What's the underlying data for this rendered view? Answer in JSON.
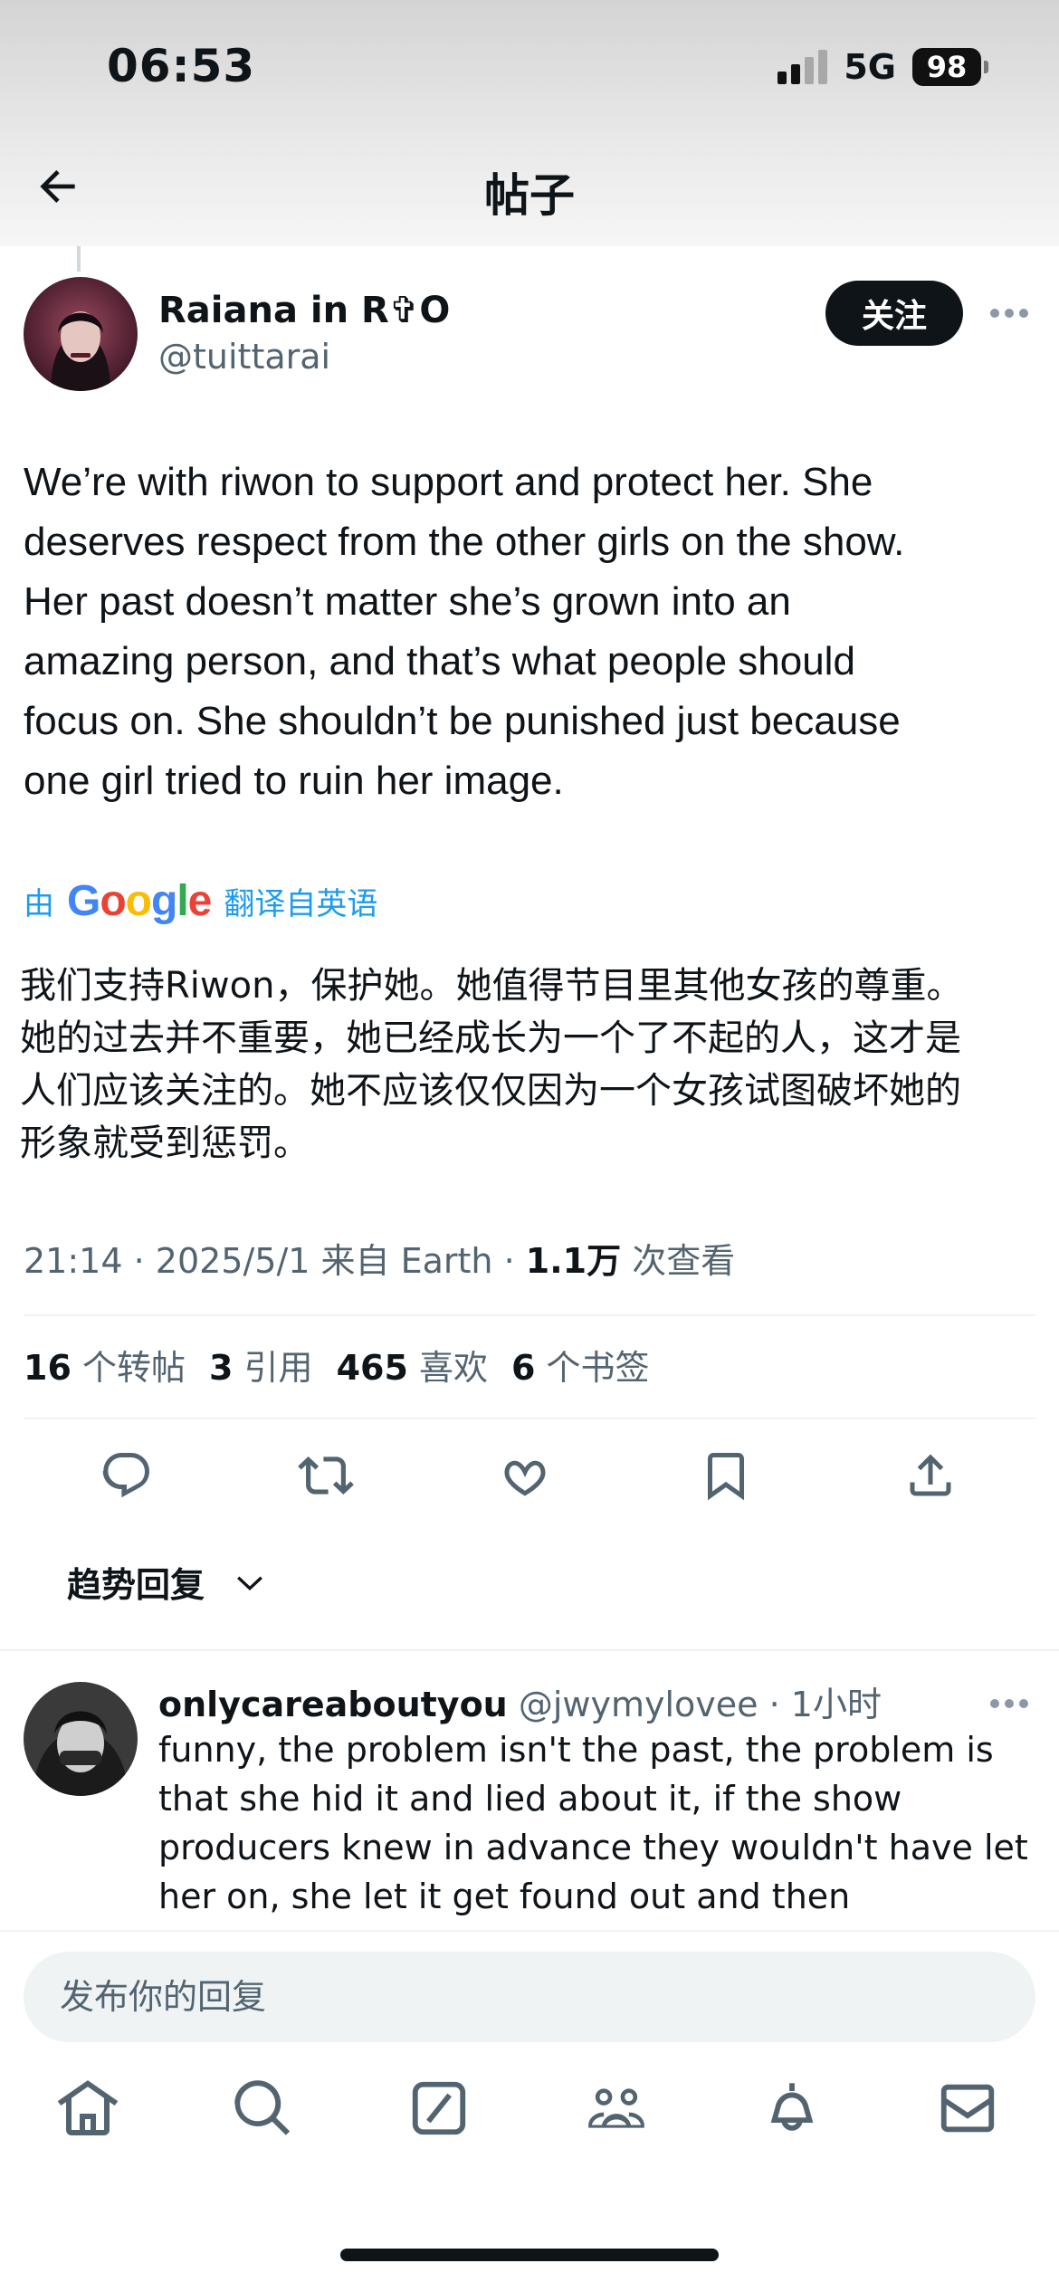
{
  "status_bar": {
    "time": "06:53",
    "network": "5G",
    "battery": "98"
  },
  "header": {
    "title": "帖子",
    "back_icon": "arrow-left-icon"
  },
  "post": {
    "author_name": "Raiana in R✞O",
    "author_handle": "@tuittarai",
    "follow_label": "关注",
    "text_lines": [
      "We’re with riwon to support and protect her. She",
      "deserves respect from the other girls on the show.",
      "Her past doesn’t matter she’s grown into an",
      "amazing person, and that’s what people should",
      "focus on. She shouldn’t be punished just because",
      "one girl tried to ruin her image."
    ],
    "translation": {
      "by": "由",
      "provider": "Google",
      "from": "翻译自英语",
      "lines": [
        "我们支持Riwon，保护她。她值得节目里其他女孩的尊重。",
        "她的过去并不重要，她已经成长为一个了不起的人，这才是",
        "人们应该关注的。她不应该仅仅因为一个女孩试图破坏她的",
        "形象就受到惩罚。"
      ]
    },
    "meta": {
      "time": "21:14",
      "date": "2025/5/1",
      "source": "来自 Earth",
      "views": "1.1万",
      "views_label": "次查看"
    },
    "stats": {
      "reposts": "16",
      "reposts_label": "个转帖",
      "quotes": "3",
      "quotes_label": "引用",
      "likes": "465",
      "likes_label": "喜欢",
      "bookmarks": "6",
      "bookmarks_label": "个书签"
    }
  },
  "sort": {
    "label": "趋势回复"
  },
  "reply": {
    "name": "onlycareaboutyou",
    "handle": "@jwymylovee",
    "time": "1小时",
    "text_lines": [
      "funny, the problem isn't the past, the problem is",
      "that she hid it and lied about it, if the show",
      "producers knew in advance they wouldn't have let",
      "her on, she let it get found out and then"
    ]
  },
  "composer": {
    "placeholder": "发布你的回复"
  },
  "colors": {
    "accent": "#1d9bf0",
    "text": "#0f1419",
    "secondary": "#536471",
    "divider": "#eff3f4"
  }
}
